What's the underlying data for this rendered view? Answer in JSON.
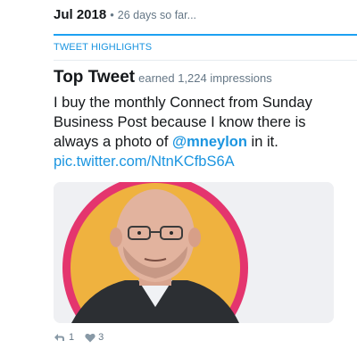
{
  "header": {
    "month": "Jul 2018",
    "separator": "•",
    "days_note": "26 days so far..."
  },
  "section": {
    "label": "TWEET HIGHLIGHTS"
  },
  "top_tweet": {
    "title": "Top Tweet",
    "impressions_text": "earned 1,224 impressions",
    "text_part1": "I buy the monthly Connect from Sunday Business Post because I know there is always a photo of",
    "mention": "@mneylon",
    "text_part2": "in it.",
    "link": "pic.twitter.com/NtnKCfbS6A",
    "media_description_icon": "photo-icon"
  },
  "actions": {
    "retweets": "1",
    "likes": "3",
    "retweet_icon": "retweet-icon",
    "like_icon": "heart-icon"
  },
  "colors": {
    "accent": "#1da1f2",
    "link": "#1b95e0",
    "muted": "#657786",
    "text": "#14171a",
    "photo_ring": "#e4356e",
    "photo_background": "#efb23f"
  }
}
